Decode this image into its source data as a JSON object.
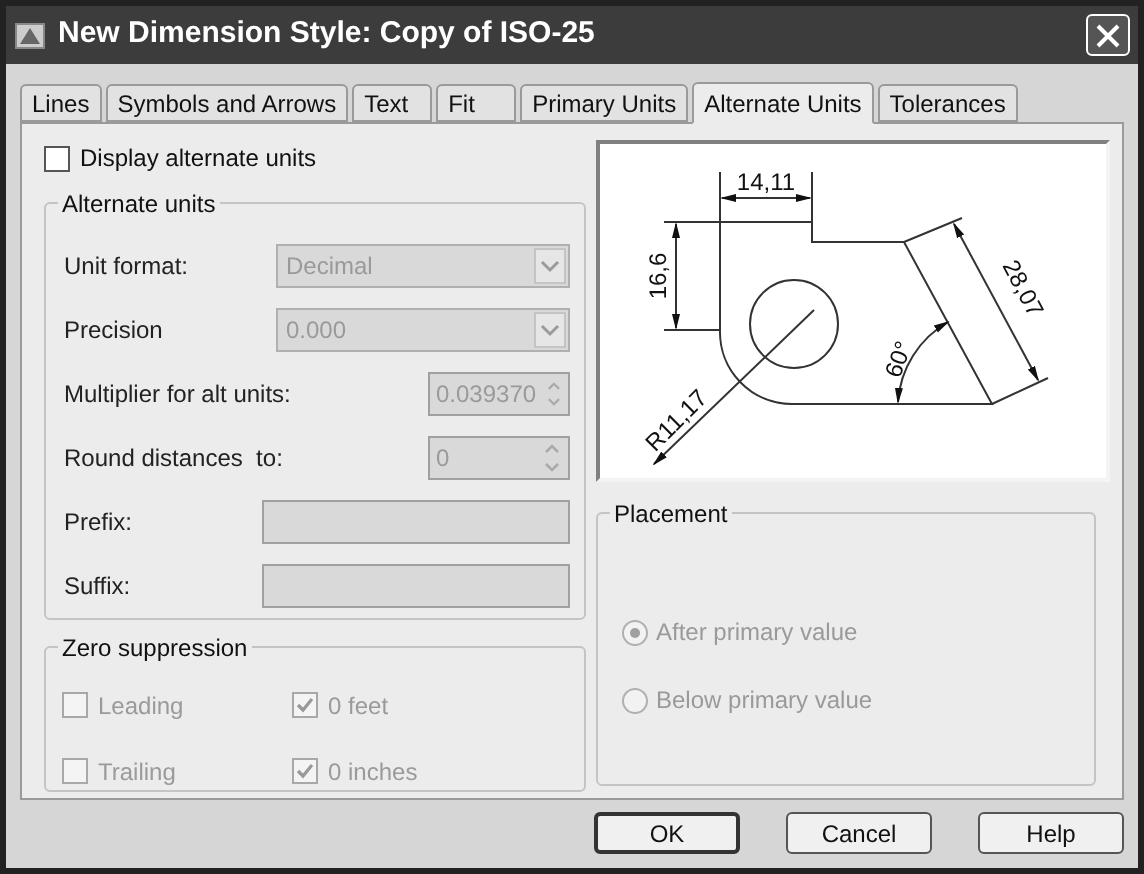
{
  "window": {
    "title": "New Dimension Style: Copy of ISO-25"
  },
  "tabs": [
    {
      "label": "Lines",
      "selected": false
    },
    {
      "label": "Symbols and Arrows",
      "selected": false
    },
    {
      "label": "Text",
      "selected": false
    },
    {
      "label": "Fit",
      "selected": false
    },
    {
      "label": "Primary Units",
      "selected": false
    },
    {
      "label": "Alternate Units",
      "selected": true
    },
    {
      "label": "Tolerances",
      "selected": false
    }
  ],
  "display_alternate_units": {
    "label": "Display alternate units",
    "checked": false
  },
  "alternate_units": {
    "title": "Alternate units",
    "disabled": true,
    "fields": [
      {
        "kind": "dropdown",
        "label": "Unit format:",
        "value": "Decimal"
      },
      {
        "kind": "dropdown",
        "label": "Precision",
        "value": "0.000"
      },
      {
        "kind": "spinner",
        "label": "Multiplier for alt units:",
        "value": "0.039370"
      },
      {
        "kind": "spinner",
        "label": "Round distances  to:",
        "value": "0"
      },
      {
        "kind": "text",
        "label": "Prefix:"
      },
      {
        "kind": "text",
        "label": "Suffix:"
      }
    ]
  },
  "preview": {
    "dimension_labels": [
      "14,11",
      "16,6",
      "28,07",
      "60°",
      "R11,17"
    ]
  },
  "zero_suppression": {
    "title": "Zero suppression",
    "disabled": true,
    "options": [
      {
        "label": "Leading",
        "checked": false
      },
      {
        "label": "0 feet",
        "checked": true
      },
      {
        "label": "Trailing",
        "checked": false
      },
      {
        "label": "0 inches",
        "checked": true
      }
    ]
  },
  "placement": {
    "title": "Placement",
    "disabled": true,
    "options": [
      {
        "label": "After primary value",
        "selected": true
      },
      {
        "label": "Below primary value",
        "selected": false
      }
    ]
  },
  "buttons": [
    {
      "label": "OK",
      "default": true
    },
    {
      "label": "Cancel",
      "default": false
    },
    {
      "label": "Help",
      "default": false
    }
  ]
}
